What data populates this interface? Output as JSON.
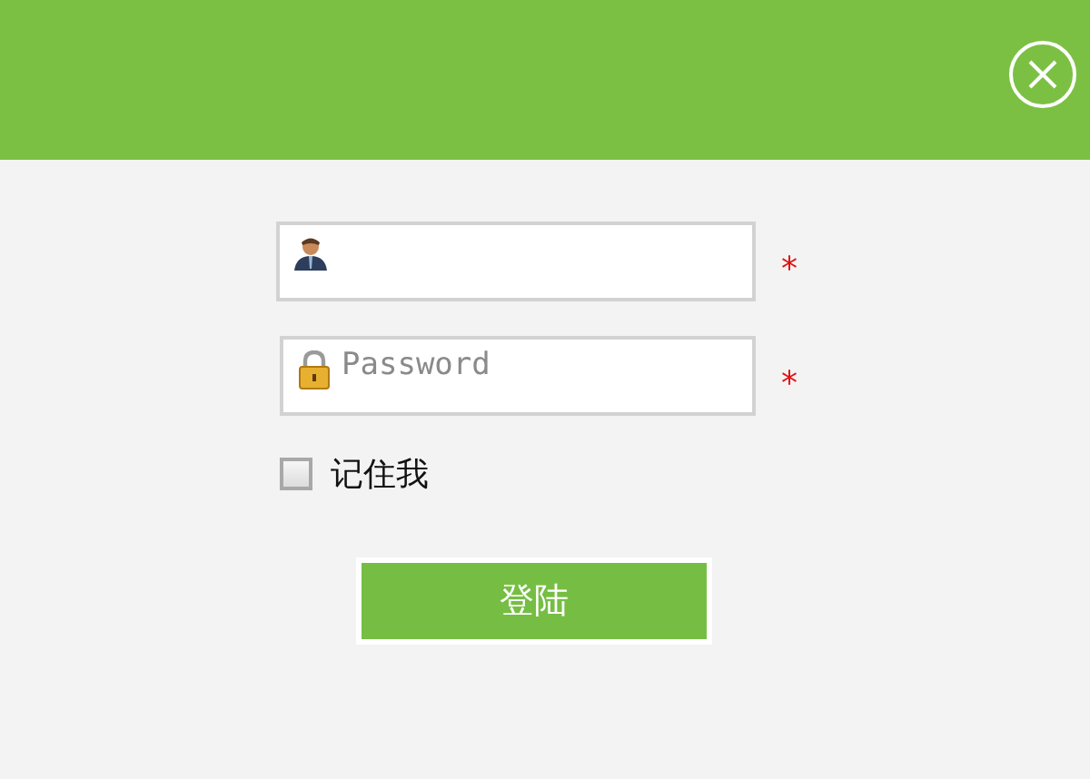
{
  "fields": [
    {
      "kind": "user",
      "required_mark": "*"
    },
    {
      "kind": "password",
      "placeholder": "Password",
      "required_mark": "*"
    }
  ],
  "remember_me": {
    "label": "记住我",
    "checked": false
  },
  "login_button": {
    "label": "登陆"
  }
}
